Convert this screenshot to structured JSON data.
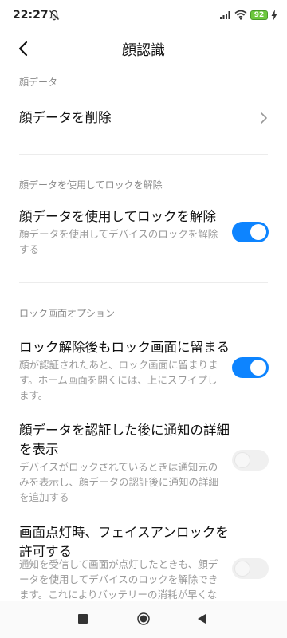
{
  "status_bar": {
    "time": "22:27",
    "battery": "92",
    "icons": [
      "notifications-off-icon",
      "signal-icon",
      "wifi-icon",
      "battery-icon",
      "charging-bolt-icon"
    ]
  },
  "header": {
    "title": "顔認識",
    "back_icon": "back-arrow-icon"
  },
  "sections": {
    "face_data": {
      "header": "顔データ",
      "delete_label": "顔データを削除"
    },
    "unlock": {
      "header": "顔データを使用してロックを解除",
      "title": "顔データを使用してロックを解除",
      "desc_line1": "顔データを使用してデバイスのロックを解除",
      "desc_line2": "する",
      "toggle": true
    },
    "lock_screen": {
      "header": "ロック画面オプション",
      "stay": {
        "title": "ロック解除後もロック画面に留まる",
        "desc_line1": "顔が認証されたあと、ロック画面に留まりま",
        "desc_line2": "す。ホーム画面を開くには、上にスワイプし",
        "desc_line3": "ます。",
        "toggle": true
      },
      "notif": {
        "title_line1": "顔データを認証した後に通知の詳細",
        "title_line2": "を表示",
        "desc_line1": "デバイスがロックされているときは通知元の",
        "desc_line2": "みを表示し、顔データの認証後に通知の詳細",
        "desc_line3": "を追加する",
        "toggle": false
      },
      "screen_on": {
        "title_line1": "画面点灯時、フェイスアンロックを",
        "title_line2": "許可する",
        "desc_line1": "通知を受信して画面が点灯したときも、顔デ",
        "desc_line2": "ータを使用してデバイスのロックを解除でき",
        "desc_line3": "ます。これによりバッテリーの消耗が早くな",
        "toggle": false
      }
    }
  },
  "colors": {
    "accent": "#0d84ff",
    "section_header": "#8a8a8a",
    "description": "#9a9a9a"
  }
}
